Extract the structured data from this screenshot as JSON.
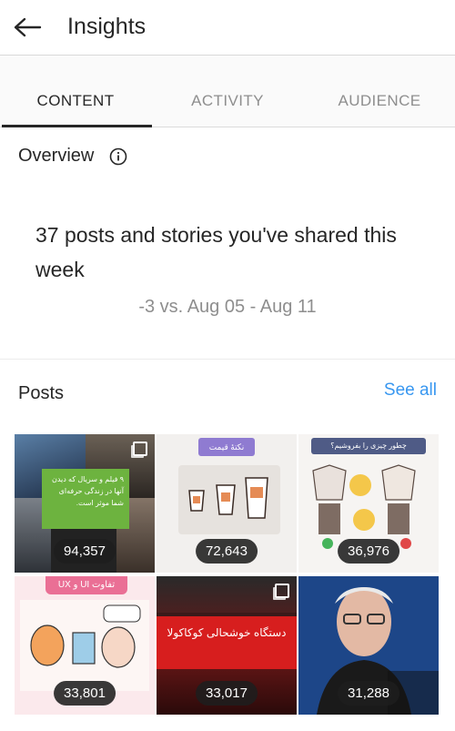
{
  "header": {
    "title": "Insights",
    "back_icon": "arrow-left-icon"
  },
  "tabs": [
    {
      "label": "CONTENT",
      "active": true
    },
    {
      "label": "ACTIVITY",
      "active": false
    },
    {
      "label": "AUDIENCE",
      "active": false
    }
  ],
  "overview": {
    "heading": "Overview",
    "info_icon": "info-circle-icon",
    "summary": "37 posts and stories you've shared this week",
    "comparison": "-3 vs. Aug 05 - Aug 11"
  },
  "posts": {
    "heading": "Posts",
    "see_all": "See all",
    "items": [
      {
        "count": "94,357",
        "multi": true,
        "overlay": "۹ فیلم و سریال که دیدن آنها در زندگی حرفه‌ای شما موثر است."
      },
      {
        "count": "72,643",
        "multi": false,
        "overlay": "نکتهٔ قیمت"
      },
      {
        "count": "36,976",
        "multi": false,
        "overlay": "چطور چیزی را بفروشیم؟"
      },
      {
        "count": "33,801",
        "multi": false,
        "overlay": "تفاوت UI و UX"
      },
      {
        "count": "33,017",
        "multi": true,
        "overlay": "دستگاه خوشحالی کوکاکولا"
      },
      {
        "count": "31,288",
        "multi": false,
        "overlay": ""
      }
    ]
  },
  "colors": {
    "link": "#3897f0",
    "text": "#262626",
    "muted": "#8e8e8e"
  }
}
